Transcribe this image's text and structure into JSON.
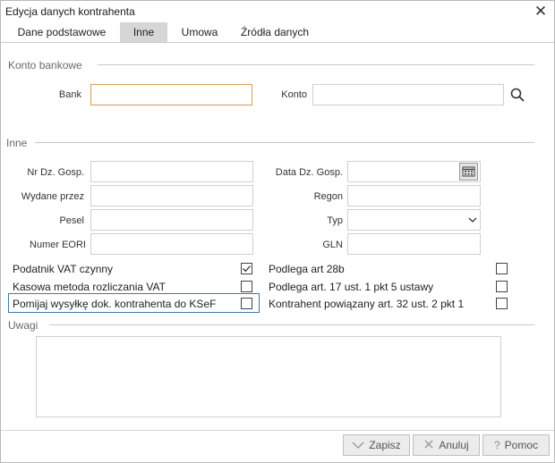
{
  "window": {
    "title": "Edycja danych kontrahenta",
    "close_glyph": "✕"
  },
  "tabs": [
    {
      "label": "Dane podstawowe",
      "active": false
    },
    {
      "label": "Inne",
      "active": true
    },
    {
      "label": "Umowa",
      "active": false
    },
    {
      "label": "Źródła danych",
      "active": false
    }
  ],
  "sections": {
    "bank": "Konto bankowe",
    "other": "Inne",
    "notes": "Uwagi"
  },
  "bank": {
    "bank_label": "Bank",
    "bank_value": "",
    "account_label": "Konto",
    "account_value": "",
    "search_icon": "search-icon"
  },
  "fields": {
    "nr_dz_gosp_label": "Nr Dz. Gosp.",
    "data_dz_gosp_label": "Data Dz. Gosp.",
    "wydane_przez_label": "Wydane przez",
    "regon_label": "Regon",
    "pesel_label": "Pesel",
    "typ_label": "Typ",
    "numer_eori_label": "Numer EORI",
    "gln_label": "GLN"
  },
  "checks": {
    "podatnik_vat": {
      "label": "Podatnik VAT czynny",
      "checked": true
    },
    "kasowa_metoda": {
      "label": "Kasowa metoda rozliczania VAT",
      "checked": false
    },
    "pomijaj_ksef": {
      "label": "Pomijaj wysyłkę dok. kontrahenta do KSeF",
      "checked": false
    },
    "podlega_28b": {
      "label": "Podlega art 28b",
      "checked": false
    },
    "podlega_17": {
      "label": "Podlega art. 17 ust. 1 pkt 5 ustawy",
      "checked": false
    },
    "powiazany_32": {
      "label": "Kontrahent powiązany art. 32 ust. 2 pkt 1",
      "checked": false
    }
  },
  "buttons": {
    "save": "Zapisz",
    "cancel": "Anuluj",
    "help": "Pomoc"
  },
  "colors": {
    "focus_orange": "#d89a52",
    "focus_blue": "#3a7ca8",
    "active_tab": "#d6d6d6"
  }
}
